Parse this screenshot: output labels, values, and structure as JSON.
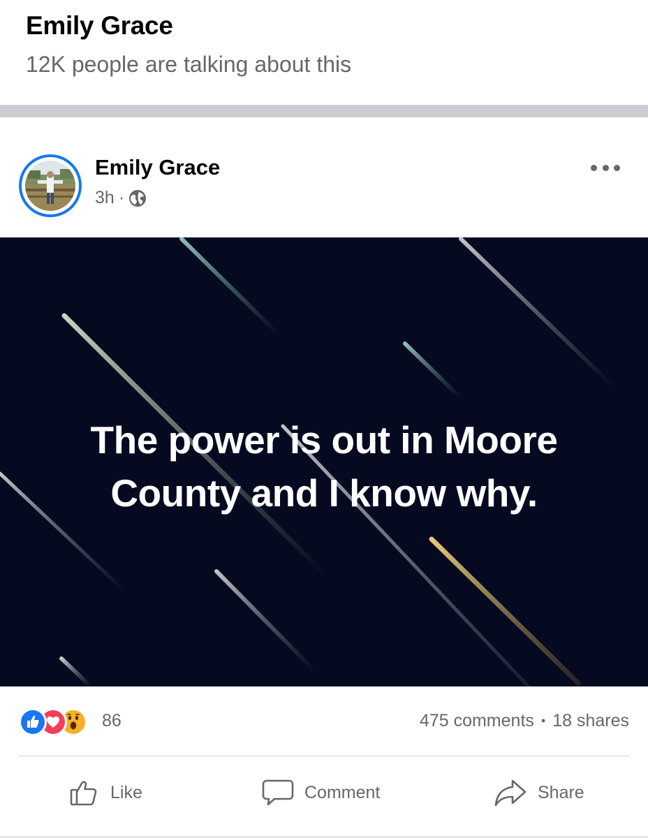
{
  "header": {
    "title": "Emily Grace",
    "subtitle": "12K people are talking about this"
  },
  "post": {
    "author": "Emily Grace",
    "time": "3h",
    "meta_separator": "·",
    "privacy_icon": "globe-icon",
    "more_icon": "more-options-icon",
    "image": {
      "caption_line1": "The power is out in Moore",
      "caption_line2": "County and I know why.",
      "background_color": "#050a20"
    },
    "reactions": {
      "icons": [
        "like-reaction-icon",
        "love-reaction-icon",
        "wow-reaction-icon"
      ],
      "count": "86"
    },
    "comments": "475 comments",
    "stats_separator": "•",
    "shares": "18 shares",
    "actions": {
      "like": "Like",
      "comment": "Comment",
      "share": "Share"
    }
  },
  "colors": {
    "accent": "#1877f2",
    "secondary_text": "#65676b",
    "love": "#f33e58",
    "wow": "#f7b125"
  }
}
